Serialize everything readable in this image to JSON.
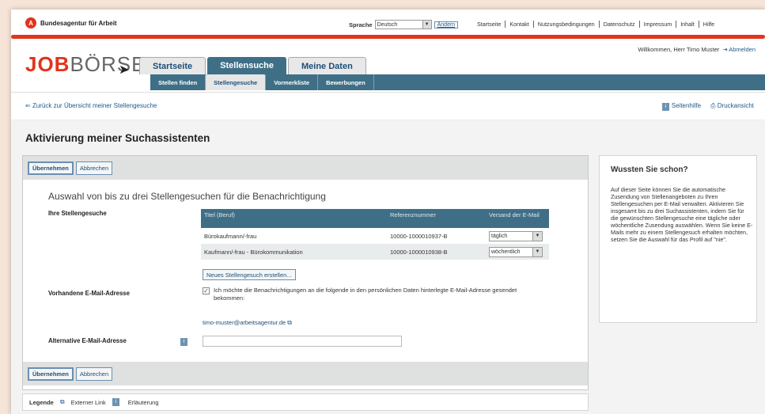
{
  "topbar": {
    "org_name": "Bundesagentur für Arbeit",
    "language_label": "Sprache",
    "language_value": "Deutsch",
    "change_button": "Ändern",
    "links": [
      "Startseite",
      "Kontakt",
      "Nutzungsbedingungen",
      "Datenschutz",
      "Impressum",
      "Inhalt",
      "Hilfe"
    ]
  },
  "header": {
    "logo_job": "JOB",
    "logo_boerse": "BÖRSE",
    "welcome": "Willkommen, Herr Timo Muster",
    "logout": "Abmelden",
    "tabs": [
      "Startseite",
      "Stellensuche",
      "Meine Daten"
    ],
    "subtabs": [
      "Stellen finden",
      "Stellengesuche",
      "Vormerkliste",
      "Bewerbungen"
    ]
  },
  "nav": {
    "back_link": "Zurück zur Übersicht meiner Stellengesuche",
    "page_help": "Seitenhilfe",
    "print_view": "Druckansicht"
  },
  "page_title": "Aktivierung meiner Suchassistenten",
  "actions": {
    "accept": "Übernehmen",
    "cancel": "Abbrechen"
  },
  "form": {
    "section_title": "Auswahl von bis zu drei Stellengesuchen für die Benachrichtigung",
    "my_requests_label": "Ihre Stellengesuche",
    "table_headers": [
      "Titel (Beruf)",
      "Referenznummer",
      "Versand der E-Mail"
    ],
    "rows": [
      {
        "title": "Bürokaufmann/-frau",
        "ref": "10000-1000010937-B",
        "dispatch": "täglich"
      },
      {
        "title": "Kaufmann/-frau - Bürokommunikation",
        "ref": "10000-1000010938-B",
        "dispatch": "wöchentlich"
      }
    ],
    "new_request_button": "Neues Stellengesuch erstellen...",
    "existing_email_label": "Vorhandene E-Mail-Adresse",
    "consent_text": "Ich möchte die Benachrichtigungen an die folgende in den persönlichen Daten hinterlegte E-Mail-Adresse gesendet bekommen:",
    "email_value": "timo-muster@arbeitsagentur.de",
    "alt_email_label": "Alternative E-Mail-Adresse",
    "alt_email_value": ""
  },
  "legend": {
    "title": "Legende",
    "external_link": "Externer Link",
    "explanation": "Erläuterung"
  },
  "sidebar": {
    "title": "Wussten Sie schon?",
    "text": "Auf dieser Seite können Sie die automatische Zusendung von Stellenangeboten zu Ihren Stellengesuchen per E-Mail verwalten. Aktivieren Sie insgesamt bis zu drei Suchassistenten, indem Sie für die gewünschten Stellengesuche eine tägliche oder wöchentliche Zusendung auswählen. Wenn Sie keine E-Mails mehr zu einem Stellengesuch erhalten möchten, setzen Sie die Auswahl für das Profil auf \"nie\"."
  },
  "icons": {
    "ba_logo_glyph": "A",
    "info_glyph": "i",
    "external_link_glyph": "⧉",
    "print_glyph": "⎙",
    "logout_glyph": "⇥",
    "dropdown_glyph": "▼",
    "check_glyph": "✓",
    "back_glyph": "⇐",
    "cursor_glyph": "➤"
  },
  "colors": {
    "brand_red": "#e2341d",
    "nav_teal": "#3f6f87",
    "link_blue": "#1d5a8e"
  }
}
